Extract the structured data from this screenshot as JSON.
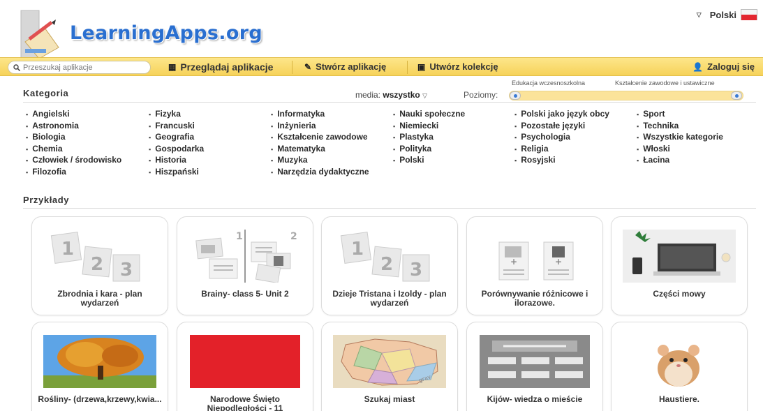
{
  "header": {
    "logo_text": "LearningApps.org",
    "language": "Polski"
  },
  "toolbar": {
    "search_placeholder": "Przeszukaj aplikacje",
    "browse_label": "Przeglądaj aplikacje",
    "create_label": "Stwórz aplikację",
    "collection_label": "Utwórz kolekcję",
    "login_label": "Zaloguj się"
  },
  "filters": {
    "category_title": "Kategoria",
    "media_label": "media:",
    "media_value": "wszystko",
    "levels_label": "Poziomy:",
    "level_min_label": "Edukacja wczesnoszkolna",
    "level_max_label": "Kształcenie zawodowe i ustawiczne"
  },
  "categories": [
    [
      "Angielski",
      "Astronomia",
      "Biologia",
      "Chemia",
      "Człowiek / środowisko",
      "Filozofia"
    ],
    [
      "Fizyka",
      "Francuski",
      "Geografia",
      "Gospodarka",
      "Historia",
      "Hiszpański"
    ],
    [
      "Informatyka",
      "Inżynieria",
      "Kształcenie zawodowe",
      "Matematyka",
      "Muzyka",
      "Narzędzia dydaktyczne"
    ],
    [
      "Nauki społeczne",
      "Niemiecki",
      "Plastyka",
      "Polityka",
      "Polski"
    ],
    [
      "Polski jako język obcy",
      "Pozostałe języki",
      "Psychologia",
      "Religia",
      "Rosyjski"
    ],
    [
      "Sport",
      "Technika",
      "Wszystkie kategorie",
      "Włoski",
      "Łacina"
    ]
  ],
  "examples": {
    "title": "Przykłady",
    "cards": [
      {
        "caption": "Zbrodnia i kara - plan wydarzeń",
        "thumb": "sequence-123-icon"
      },
      {
        "caption": "Brainy- class 5- Unit 2",
        "thumb": "pair-matching-icon"
      },
      {
        "caption": "Dzieje Tristana i Izoldy - plan wydarzeń",
        "thumb": "sequence-123-icon"
      },
      {
        "caption": "Porównywanie różnicowe i ilorazowe.",
        "thumb": "pair-cards-icon"
      },
      {
        "caption": "Części mowy",
        "thumb": "laptop-desk-photo"
      },
      {
        "caption": "Rośliny- (drzewa,krzewy,kwia...",
        "thumb": "autumn-tree-photo"
      },
      {
        "caption": "Narodowe Święto Niepodległości - 11",
        "thumb": "red-square"
      },
      {
        "caption": "Szukaj miast",
        "thumb": "poland-map-photo"
      },
      {
        "caption": "Kijów- wiedza o mieście",
        "thumb": "form-gaps-icon"
      },
      {
        "caption": "Haustiere.",
        "thumb": "hamster-photo"
      }
    ]
  },
  "colors": {
    "toolbar": "#f6d25a",
    "logo_blue": "#2a6fd0",
    "accent_blue": "#3a7bd5"
  }
}
